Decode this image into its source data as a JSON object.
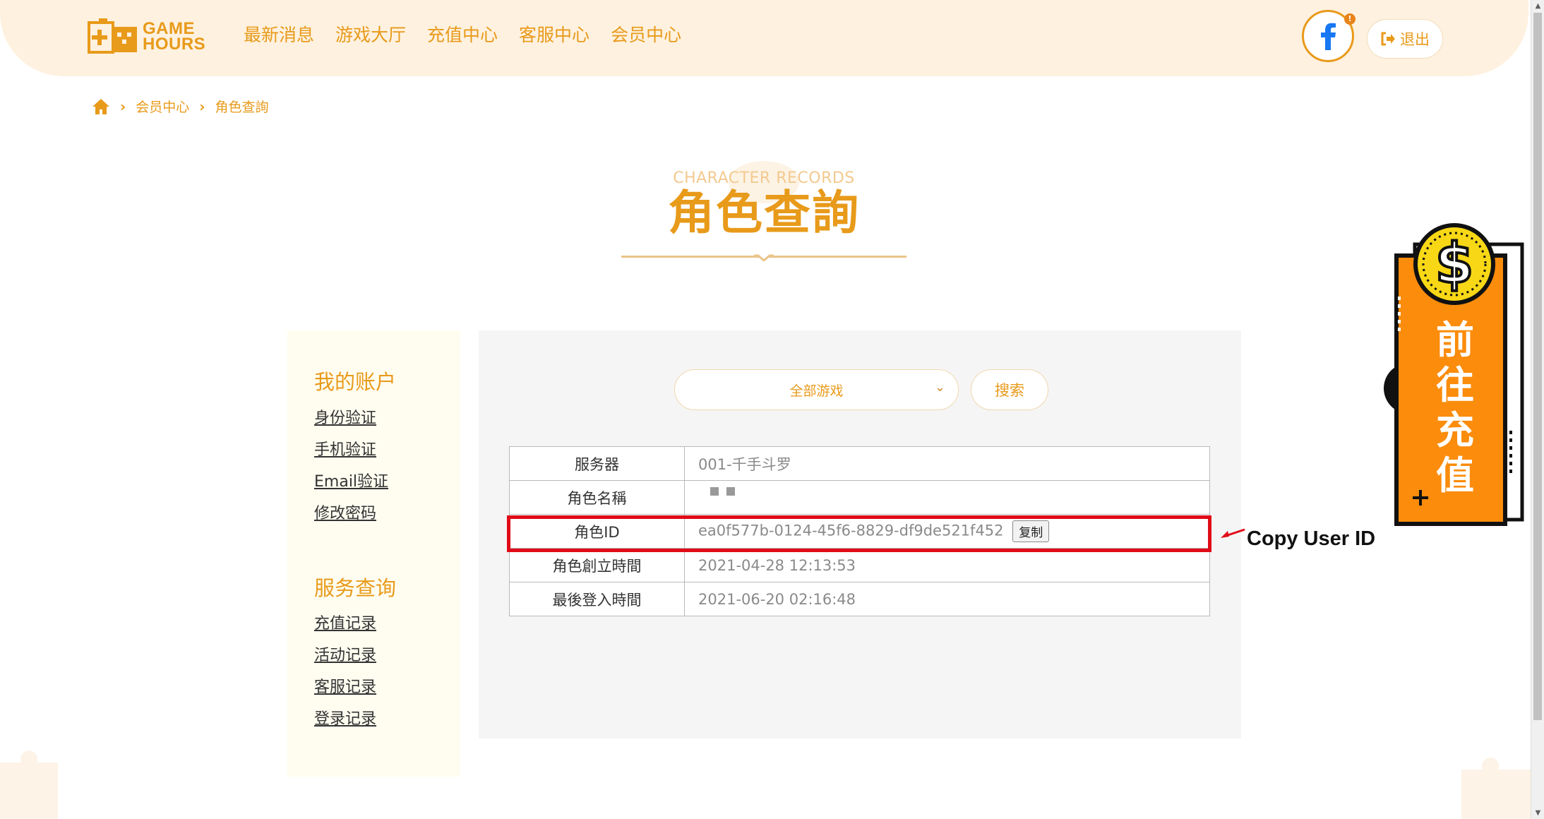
{
  "header": {
    "logo_text_line1": "GAME",
    "logo_text_line2": "HOURS",
    "nav": [
      "最新消息",
      "游戏大厅",
      "充值中心",
      "客服中心",
      "会员中心"
    ],
    "facebook_badge": "!",
    "logout_label": "退出"
  },
  "breadcrumb": {
    "items": [
      "会员中心",
      "角色查詢"
    ]
  },
  "page_title": {
    "english": "CHARACTER RECORDS",
    "chinese": "角色查詢"
  },
  "sidebar": {
    "sections": [
      {
        "heading": "我的账户",
        "links": [
          "身份验证",
          "手机验证",
          "Email验证",
          "修改密码"
        ]
      },
      {
        "heading": "服务查询",
        "links": [
          "充值记录",
          "活动记录",
          "客服记录",
          "登录记录"
        ]
      }
    ]
  },
  "search": {
    "game_select_value": "全部游戏",
    "search_button": "搜索"
  },
  "character_table": {
    "rows": [
      {
        "label": "服务器",
        "value": "001-千手斗罗"
      },
      {
        "label": "角色名稱",
        "value": ""
      },
      {
        "label": "角色ID",
        "value": "ea0f577b-0124-45f6-8829-df9de521f452"
      },
      {
        "label": "角色創立時間",
        "value": "2021-04-28 12:13:53"
      },
      {
        "label": "最後登入時間",
        "value": "2021-06-20 02:16:48"
      }
    ],
    "copy_button": "复制"
  },
  "annotation": {
    "text": "Copy User ID",
    "color": "#e10b18"
  },
  "recharge_widget": {
    "label": "前往充值",
    "coin_symbol": "$"
  },
  "colors": {
    "accent": "#e89a1a",
    "header_bg": "#fef1df",
    "widget_orange": "#fb8c0c",
    "highlight_red": "#e10b18"
  }
}
